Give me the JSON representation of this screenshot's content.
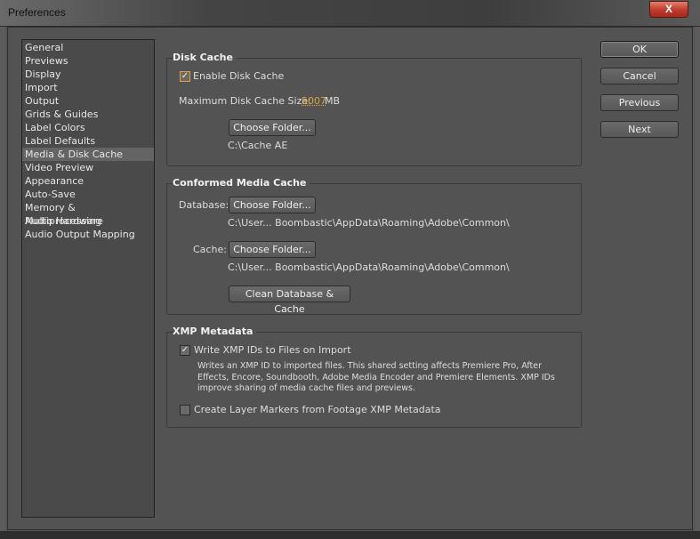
{
  "window": {
    "title": "Preferences",
    "close_label": "X"
  },
  "sidebar": {
    "items": [
      "General",
      "Previews",
      "Display",
      "Import",
      "Output",
      "Grids & Guides",
      "Label Colors",
      "Label Defaults",
      "Media & Disk Cache",
      "Video Preview",
      "Appearance",
      "Auto-Save",
      "Memory & Multiprocessing",
      "Audio Hardware",
      "Audio Output Mapping"
    ],
    "selected": "Media & Disk Cache"
  },
  "disk_cache": {
    "title": "Disk Cache",
    "enable_label": "Enable Disk Cache",
    "enable_checked": true,
    "max_size_label": "Maximum Disk Cache Size:",
    "max_size_value": "5007",
    "max_size_unit": "MB",
    "choose_folder": "Choose Folder...",
    "path": "C:\\Cache AE"
  },
  "conformed": {
    "title": "Conformed Media Cache",
    "database_label": "Database:",
    "database_button": "Choose Folder...",
    "database_path": "C:\\User... Boombastic\\AppData\\Roaming\\Adobe\\Common\\",
    "cache_label": "Cache:",
    "cache_button": "Choose Folder...",
    "cache_path": "C:\\User... Boombastic\\AppData\\Roaming\\Adobe\\Common\\",
    "clean_button": "Clean Database & Cache"
  },
  "xmp": {
    "title": "XMP Metadata",
    "write_label": "Write XMP IDs to Files on Import",
    "write_checked": true,
    "write_desc": "Writes an XMP ID to imported files. This shared setting affects Premiere Pro, After Effects, Encore, Soundbooth, Adobe Media Encoder and Premiere Elements. XMP IDs improve sharing of media cache files and previews.",
    "markers_label": "Create Layer Markers from Footage XMP Metadata",
    "markers_checked": false
  },
  "buttons": {
    "ok": "OK",
    "cancel": "Cancel",
    "previous": "Previous",
    "next": "Next"
  },
  "colors": {
    "accent": "#d9a43a"
  }
}
